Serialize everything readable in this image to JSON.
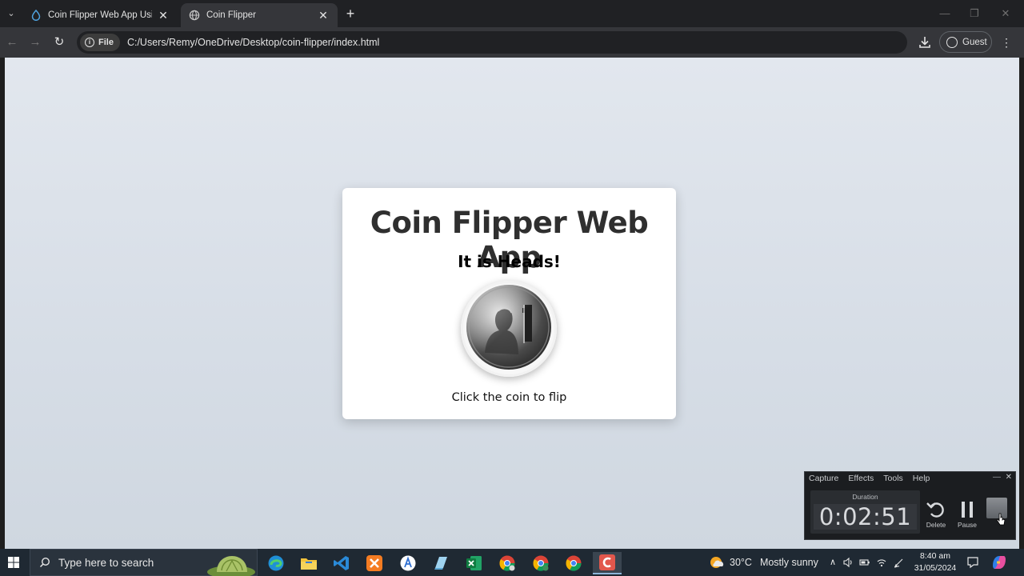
{
  "browser": {
    "tabs": [
      {
        "title": "Coin Flipper Web App Using HT",
        "active": false
      },
      {
        "title": "Coin Flipper",
        "active": true
      }
    ],
    "omnibox": {
      "chip_label": "File",
      "url": "C:/Users/Remy/OneDrive/Desktop/coin-flipper/index.html"
    },
    "profile_label": "Guest"
  },
  "page": {
    "title": "Coin Flipper Web App",
    "result": "It is Heads!",
    "coin_side": "heads",
    "hint": "Click the coin to flip"
  },
  "recorder": {
    "menu": [
      "Capture",
      "Effects",
      "Tools",
      "Help"
    ],
    "duration_label": "Duration",
    "duration": "0:02:51",
    "delete_label": "Delete",
    "pause_label": "Pause"
  },
  "taskbar": {
    "search_placeholder": "Type here to search",
    "weather": {
      "temp": "30°C",
      "condition": "Mostly sunny"
    },
    "time": "8:40 am",
    "date": "31/05/2024"
  },
  "colors": {
    "browser_chrome": "#35363a",
    "tab_strip": "#202124",
    "page_bg": "#dde3ea",
    "card_bg": "#ffffff",
    "taskbar_bg": "#1f2933"
  }
}
